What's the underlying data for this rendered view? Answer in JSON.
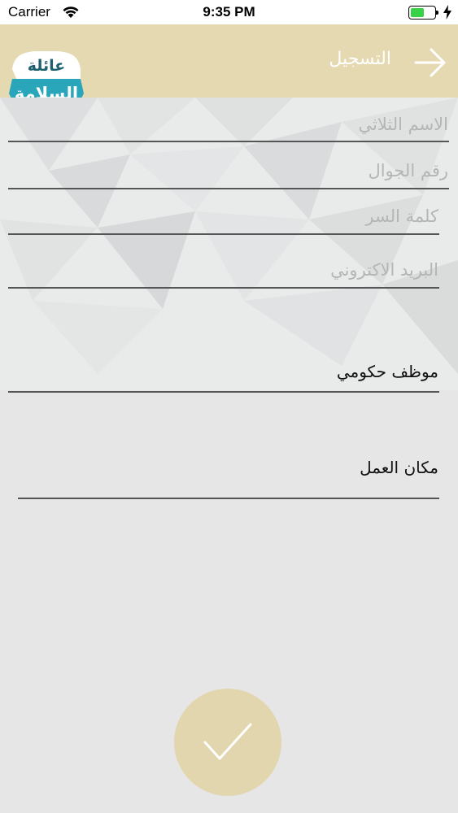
{
  "status_bar": {
    "carrier": "Carrier",
    "time": "9:35 PM",
    "battery_level": 0.6
  },
  "header": {
    "title": "التسجيل",
    "back_icon": "arrow-right-icon",
    "logo": {
      "line1": "عائلة",
      "line2": "السلامة"
    }
  },
  "form": {
    "full_name": {
      "placeholder": "الاسم الثلاثي",
      "value": ""
    },
    "mobile": {
      "placeholder": "رقم الجوال",
      "value": ""
    },
    "password": {
      "placeholder": "كلمة السر",
      "value": ""
    },
    "email": {
      "placeholder": "البريد الاكتروني",
      "value": ""
    },
    "employment_type": {
      "selected": "موظف حكومي"
    },
    "workplace": {
      "selected": "مكان العمل"
    }
  },
  "submit": {
    "icon": "check-icon"
  },
  "colors": {
    "header_bg": "#e5d9b1",
    "submit_bg": "#e1d6ae",
    "logo_teal": "#2aa6bb",
    "logo_text_dark": "#1d6070",
    "page_bg": "#e6e6e7"
  }
}
